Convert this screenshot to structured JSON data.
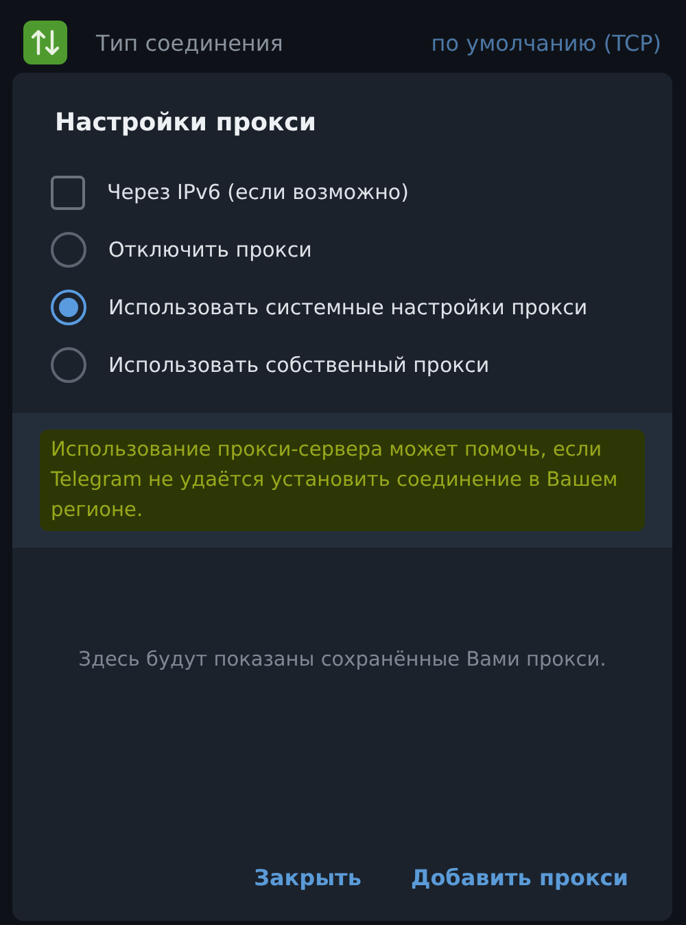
{
  "setting_row": {
    "label": "Тип соединения",
    "value": "по умолчанию (TCP)"
  },
  "dialog": {
    "title": "Настройки прокси",
    "options": [
      {
        "kind": "checkbox",
        "label": "Через IPv6 (если возможно)",
        "checked": false
      },
      {
        "kind": "radio",
        "label": "Отключить прокси",
        "selected": false
      },
      {
        "kind": "radio",
        "label": "Использовать системные настройки прокси",
        "selected": true
      },
      {
        "kind": "radio",
        "label": "Использовать собственный прокси",
        "selected": false
      }
    ],
    "info": "Использование прокси-сервера может помочь, если Telegram не удаётся установить соединение в Вашем регионе.",
    "empty_text": "Здесь будут показаны сохранённые Вами прокси.",
    "buttons": [
      "Закрыть",
      "Добавить прокси"
    ]
  }
}
